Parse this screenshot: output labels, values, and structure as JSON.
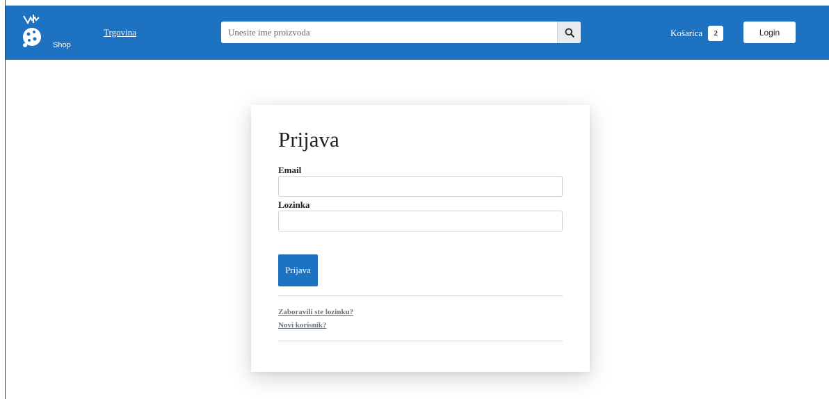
{
  "navbar": {
    "brand_color": "#1e72c2",
    "logo_text": "Shop",
    "shop_link": "Trgovina",
    "search": {
      "placeholder": "Unesite ime proizvoda",
      "value": "",
      "icon": "search-icon"
    },
    "cart": {
      "label": "Košarica",
      "count": "2"
    },
    "login_label": "Login"
  },
  "login_form": {
    "title": "Prijava",
    "email_label": "Email",
    "email_value": "",
    "password_label": "Lozinka",
    "password_value": "",
    "submit_label": "Prijava",
    "forgot_link": "Zaboravili ste lozinku?",
    "register_link": "Novi korisnik?"
  }
}
